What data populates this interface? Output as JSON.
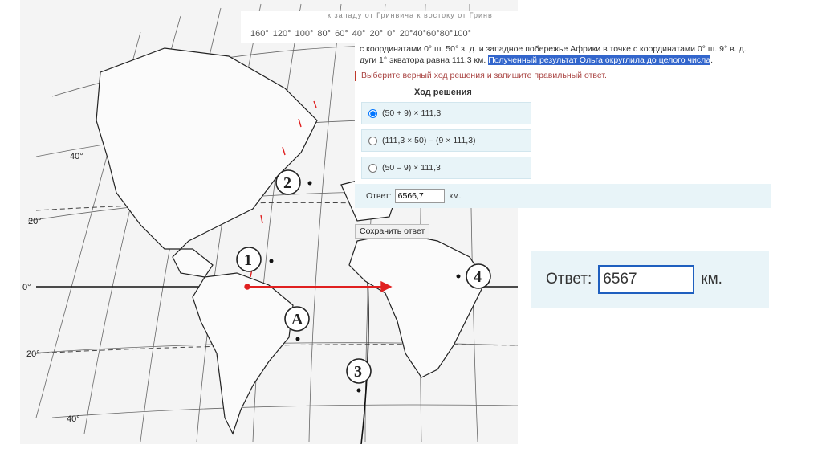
{
  "map": {
    "top_caption": "к западу от Гринвича  к востоку от Гринв",
    "longitude_scale": "160° 120° 100° 80° 60° 40° 20° 0° 20°40°60°80°100°",
    "lat_labels": [
      "40°",
      "20°",
      "0°",
      "20°",
      "40°"
    ],
    "points": [
      "1",
      "2",
      "3",
      "4",
      "А"
    ]
  },
  "question": {
    "line1": "с координатами 0° ш. 50° з. д. и западное побережье Африки в точке с координатами 0° ш. 9° в. д.",
    "line2_plain": "дуги 1° экватора равна 111,3 км. ",
    "line2_highlight": "Полученный результат Ольга округлила до целого числа",
    "line2_end": ".",
    "instruction": "Выберите верный ход решения и запишите правильный ответ.",
    "solution_title": "Ход решения"
  },
  "options": [
    {
      "label": "(50 + 9) × 111,3",
      "checked": true
    },
    {
      "label": "(111,3 × 50) – (9 × 111,3)",
      "checked": false
    },
    {
      "label": "(50 – 9) × 111,3",
      "checked": false
    }
  ],
  "answer": {
    "label": "Ответ:",
    "value": "6566,7",
    "unit": "км."
  },
  "save_button": "Сохранить ответ",
  "zoom": {
    "label": "Ответ:",
    "value": "6567",
    "unit": "км."
  },
  "colors": {
    "accent": "#1f5fbf",
    "arrow": "#e02020",
    "option_bg": "#e8f4f8",
    "highlight": "#3366cc"
  }
}
